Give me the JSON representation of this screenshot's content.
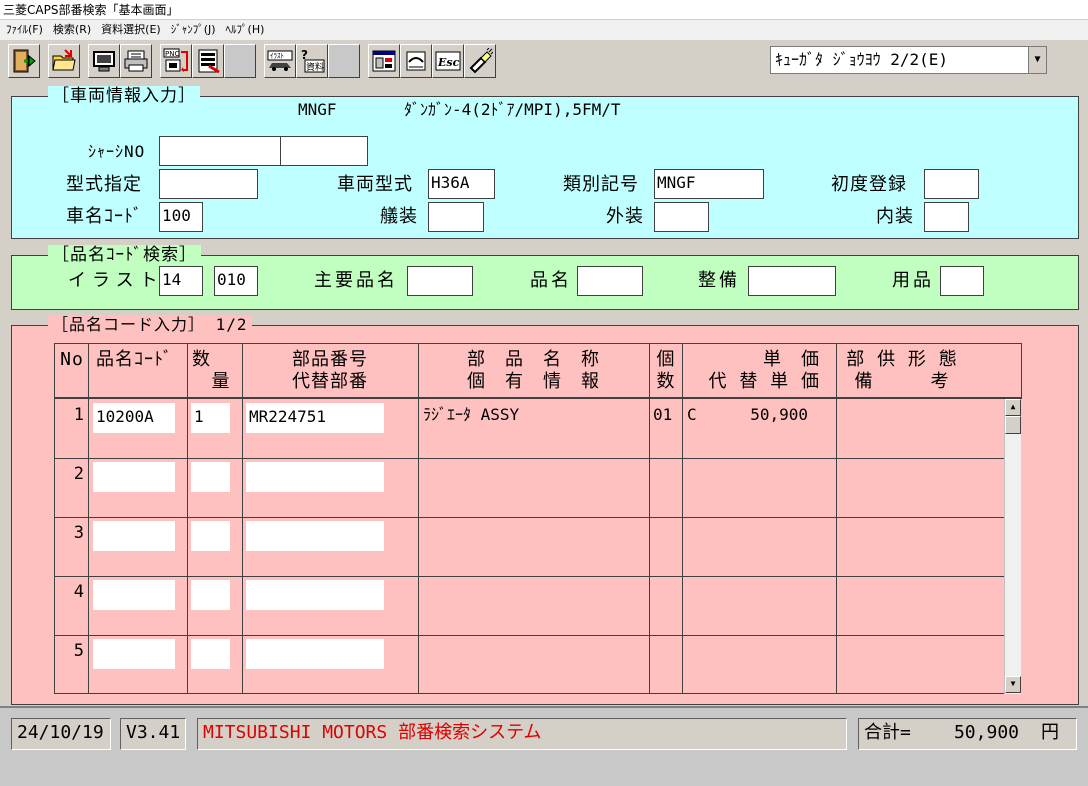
{
  "window": {
    "title": "三菱CAPS部番検索「基本画面」"
  },
  "menu": [
    "ﾌｧｲﾙ(F)",
    "検索(R)",
    "資料選択(E)",
    "ｼﾞｬﾝﾌﾟ(J)",
    "ﾍﾙﾌﾟ(H)"
  ],
  "toolbar": {
    "pnc_label": "PNC",
    "esc_label": "Esc",
    "illust_label": "ｲﾗｽﾄ",
    "doc_label": "資料",
    "combo_value": "ｷｭｰｶﾞﾀ ｼﾞｮｳﾖｳ 2/2(E)"
  },
  "vehicle": {
    "legend": "［車両情報入力］",
    "model_code": "MNGF",
    "model_desc": "ﾀﾞﾝｶﾞﾝ-4(2ﾄﾞｱ/MPI),5FM/T",
    "chassis_label": "ｼｬｰｼNO",
    "chassis_value1": "",
    "chassis_value2": "",
    "type_spec_label": "型式指定",
    "type_spec_value": "",
    "vehicle_type_label": "車両型式",
    "vehicle_type_value": "H36A",
    "class_code_label": "類別記号",
    "class_code_value": "MNGF",
    "first_reg_label": "初度登録",
    "first_reg_value": "",
    "car_name_label": "車名ｺｰﾄﾞ",
    "car_name_value": "100",
    "trim_label": "艤装",
    "trim_value": "",
    "exterior_label": "外装",
    "exterior_value": "",
    "interior_label": "内装",
    "interior_value": ""
  },
  "search": {
    "legend": "［品名ｺｰﾄﾞ検索］",
    "illust_label": "イラスト",
    "illust_value1": "14",
    "illust_value2": "010",
    "main_name_label": "主要品名",
    "main_name_value": "",
    "part_name_label": "品名",
    "part_name_value": "",
    "service_label": "整備",
    "service_value": "",
    "supplies_label": "用品",
    "supplies_value": ""
  },
  "entry": {
    "legend": "［品名コード入力］ 1/2",
    "headers": {
      "no": "No",
      "code": "品名ｺｰﾄﾞ",
      "qty1": "数",
      "qty2": "量",
      "partno1": "部品番号",
      "partno2": "代替部番",
      "name1": "部　品　名　称",
      "name2": "個　有　情　報",
      "count1": "個",
      "count2": "数",
      "price1": "単　価",
      "price2": "代 替 単 価",
      "supply1": "部 供 形 態",
      "supply2": "備　　　考"
    },
    "rows": [
      {
        "no": "1",
        "code": "10200A",
        "qty": "1",
        "part_no": "MR224751",
        "name": "ﾗｼﾞｴｰﾀ ASSY",
        "count": "01",
        "price_code": "C",
        "price": "50,900",
        "remarks": ""
      },
      {
        "no": "2",
        "code": "",
        "qty": "",
        "part_no": "",
        "name": "",
        "count": "",
        "price_code": "",
        "price": "",
        "remarks": ""
      },
      {
        "no": "3",
        "code": "",
        "qty": "",
        "part_no": "",
        "name": "",
        "count": "",
        "price_code": "",
        "price": "",
        "remarks": ""
      },
      {
        "no": "4",
        "code": "",
        "qty": "",
        "part_no": "",
        "name": "",
        "count": "",
        "price_code": "",
        "price": "",
        "remarks": ""
      },
      {
        "no": "5",
        "code": "",
        "qty": "",
        "part_no": "",
        "name": "",
        "count": "",
        "price_code": "",
        "price": "",
        "remarks": ""
      }
    ]
  },
  "status": {
    "date": "24/10/19",
    "version": "V3.41",
    "message": "MITSUBISHI MOTORS 部番検索システム",
    "total_label": "合計=",
    "total_value": "50,900",
    "currency": "円"
  },
  "colors": {
    "vehicle_panel": "#c0ffff",
    "search_panel": "#c0ffc0",
    "entry_panel": "#ffc0c0",
    "status_message": "#e00000"
  }
}
